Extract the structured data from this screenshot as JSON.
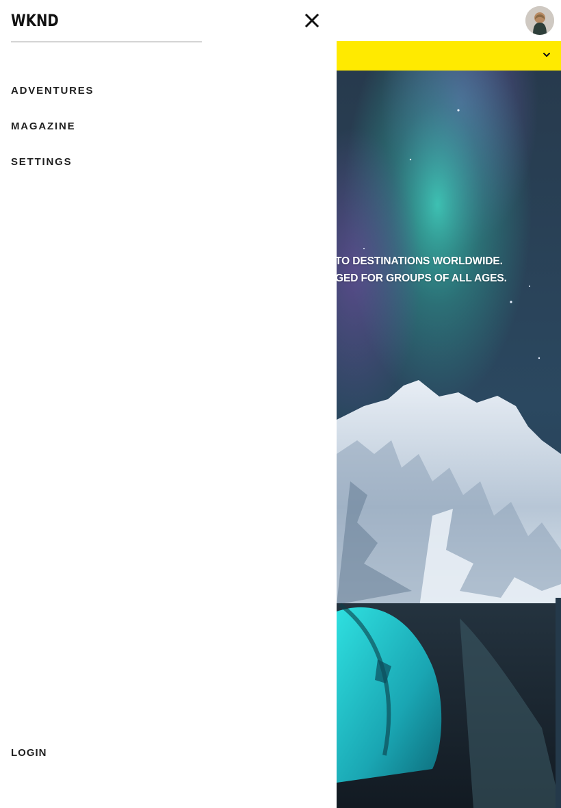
{
  "header": {
    "logo_text": "WKND",
    "close_icon": "close-icon",
    "avatar_icon": "user-avatar"
  },
  "navigation": {
    "items": [
      {
        "label": "ADVENTURES"
      },
      {
        "label": "MAGAZINE"
      },
      {
        "label": "SETTINGS"
      }
    ],
    "login_label": "LOGIN"
  },
  "background_page": {
    "dropdown_icon": "chevron-down-icon",
    "hero_line_1": "TO DESTINATIONS WORLDWIDE.",
    "hero_line_2": "GED FOR GROUPS OF ALL AGES."
  },
  "colors": {
    "accent_yellow": "#ffea00",
    "text_dark": "#202020",
    "drawer_background": "#ffffff",
    "divider": "#d4d4d4"
  }
}
